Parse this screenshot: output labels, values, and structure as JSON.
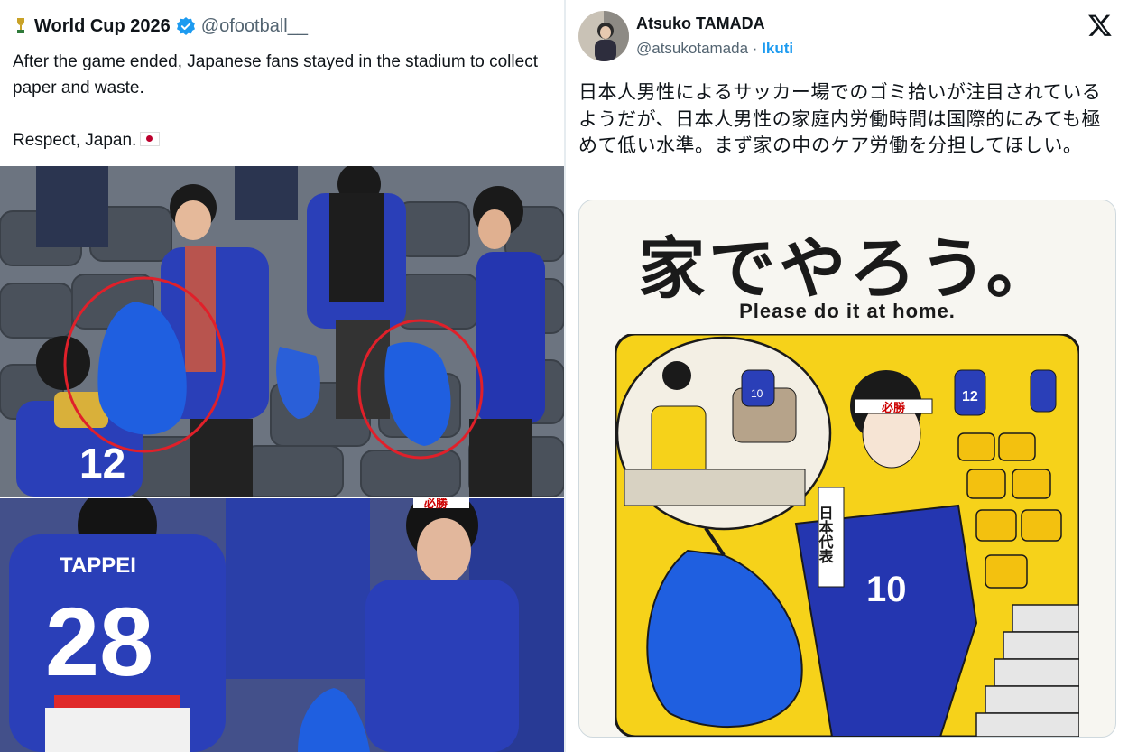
{
  "left_tweet": {
    "account_name": "World Cup 2026",
    "handle": "@ofootball__",
    "line1": "After the game ended, Japanese fans stayed in the stadium to collect paper and waste.",
    "line2": "Respect, Japan.",
    "icons": [
      "trophy-icon",
      "verified-badge-icon",
      "japan-flag-icon"
    ],
    "photo_top": {
      "jersey_number": "12"
    },
    "photo_bottom": {
      "jersey_name": "TAPPEI",
      "jersey_number": "28",
      "headband_text": "必勝"
    }
  },
  "right_tweet": {
    "author_name": "Atsuko TAMADA",
    "handle": "@atsukotamada",
    "separator": "·",
    "follow_label": "Ikuti",
    "icons": [
      "x-logo-icon"
    ],
    "body": "日本人男性によるサッカー場でのゴミ拾いが注目されているようだが、日本人男性の家庭内労働時間は国際的にみても極めて低い水準。まず家の中のケア労働を分担してほしい。",
    "card": {
      "title": "家でやろう。",
      "subtitle": "Please do it at home.",
      "headband_text": "必勝",
      "scarf_text": "日本代表",
      "jersey_number": "10",
      "tv_jersey_number": "10",
      "background_fan_number": "12"
    }
  },
  "colors": {
    "jersey_blue": "#2a3fb8",
    "bag_blue": "#1f5fe0",
    "highlight_circle": "#e0202a",
    "illustration_yellow": "#f6d21a",
    "link_blue": "#1d9bf0",
    "verified_blue": "#1d9bf0"
  }
}
